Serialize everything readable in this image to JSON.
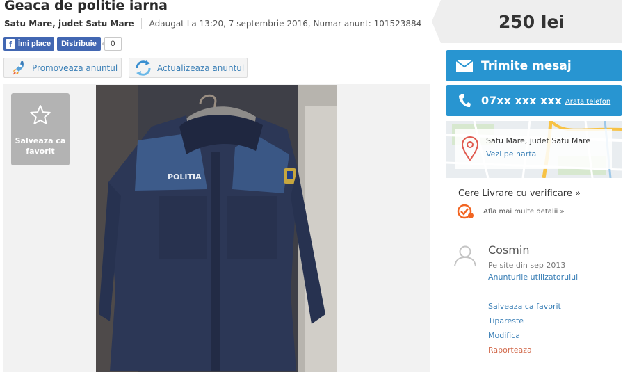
{
  "ad": {
    "title": "Geaca de politie iarna",
    "location": "Satu Mare, judet Satu Mare",
    "meta": "Adaugat La 13:20, 7 septembrie 2016, Numar anunt: 101523884"
  },
  "social": {
    "like_label": "Îmi place",
    "share_label": "Distribuie",
    "count": "0"
  },
  "toolbar": {
    "promote_label": "Promoveaza anuntul",
    "update_label": "Actualizeaza anuntul"
  },
  "gallery": {
    "favorite_label": "Salveaza ca favorit",
    "photo_text": "POLITIA"
  },
  "sidebar": {
    "price": "250 lei",
    "message_label": "Trimite mesaj",
    "phone_number": "07xx xxx xxx",
    "show_phone_label": "Arata telefon",
    "map": {
      "location": "Satu Mare, judet Satu Mare",
      "view_map_label": "Vezi pe harta"
    },
    "delivery": {
      "title": "Cere Livrare cu verificare »",
      "info_label": "Afla mai multe detalii »"
    },
    "user": {
      "name": "Cosmin",
      "since": "Pe site din sep 2013",
      "ads_link": "Anunturile utilizatorului"
    },
    "actions": [
      {
        "label": "Salveaza ca favorit"
      },
      {
        "label": "Tipareste"
      },
      {
        "label": "Modifica"
      },
      {
        "label": "Raporteaza"
      }
    ]
  },
  "colors": {
    "accent_blue": "#2895d1",
    "link_blue": "#3a7fb6",
    "facebook_blue": "#4267b2",
    "report_red": "#d26a4c",
    "delivery_orange": "#f26522"
  }
}
